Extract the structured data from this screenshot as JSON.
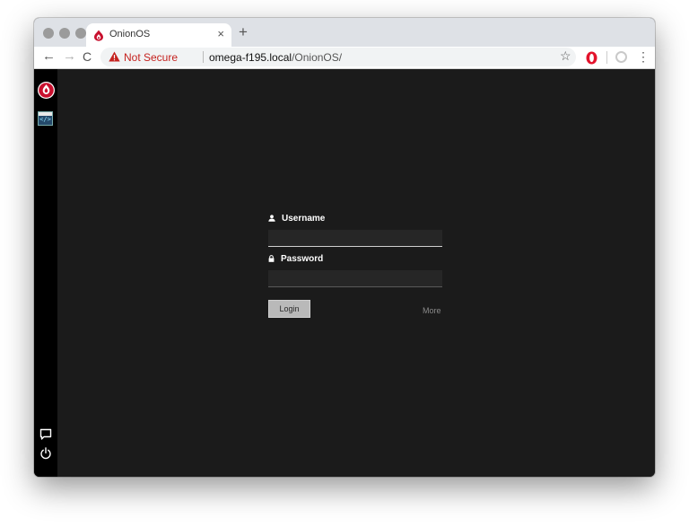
{
  "browser": {
    "tab_title": "OnionOS",
    "tab_close": "×",
    "new_tab": "+",
    "nav": {
      "back": "←",
      "forward": "→",
      "reload": "C"
    },
    "address": {
      "security_label": "Not Secure",
      "url_host": "omega-f195.local",
      "url_path": "/OnionOS/"
    },
    "toolbar": {
      "bookmark": "☆",
      "menu": "⋮"
    }
  },
  "sidebar": {
    "apps": [
      {
        "name": "OnionOS logo",
        "icon": "onion-icon"
      },
      {
        "name": "Code editor",
        "icon": "code-icon",
        "label": "</>"
      }
    ],
    "bottom": [
      {
        "icon": "chat-icon"
      },
      {
        "icon": "power-icon"
      }
    ]
  },
  "login": {
    "username_label": "Username",
    "username_value": "",
    "password_label": "Password",
    "password_value": "",
    "login_button": "Login",
    "more_link": "More"
  },
  "colors": {
    "page_bg": "#1b1b1b",
    "sidebar_bg": "#000000",
    "onion_red": "#c8102e",
    "warning_red": "#c5221f"
  }
}
